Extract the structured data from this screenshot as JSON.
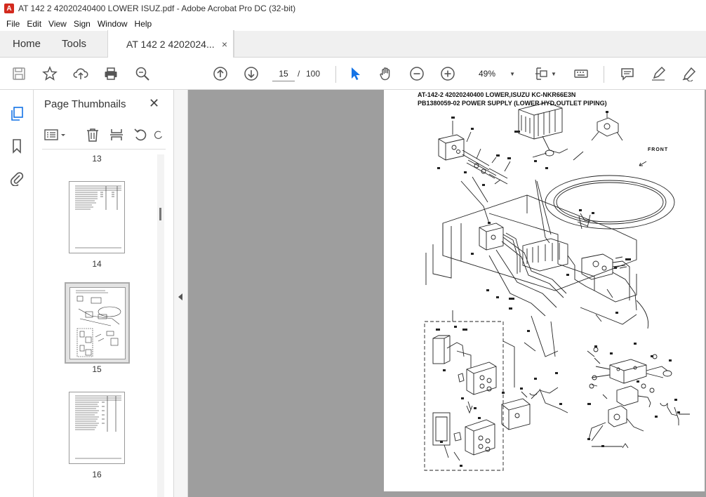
{
  "window": {
    "title": "AT 142 2 42020240400 LOWER ISUZ.pdf - Adobe Acrobat Pro DC (32-bit)",
    "app_icon_glyph": "A"
  },
  "menu": [
    "File",
    "Edit",
    "View",
    "Sign",
    "Window",
    "Help"
  ],
  "tabs": {
    "home": "Home",
    "tools": "Tools",
    "document": "AT 142 2 4202024...",
    "close_glyph": "×"
  },
  "toolbar": {
    "icons": [
      "save-icon",
      "star-icon",
      "upload-icon",
      "print-icon",
      "zoom-search-icon",
      "page-up-icon",
      "page-down-icon",
      "select-arrow-icon",
      "hand-icon",
      "zoom-out-icon",
      "zoom-in-icon",
      "fit-page-icon",
      "keyboard-icon",
      "comment-icon",
      "highlight-icon",
      "sign-icon"
    ],
    "current_page": "15",
    "page_separator": "/",
    "total_pages": "100",
    "zoom": "49%"
  },
  "left_rail": {
    "icons": [
      "page-thumbnails-icon",
      "bookmark-icon",
      "attachment-icon"
    ]
  },
  "thumbnail_panel": {
    "title": "Page Thumbnails",
    "close_glyph": "✕",
    "tools": [
      "thumbnail-options-icon",
      "delete-page-icon",
      "extract-page-icon",
      "rotate-left-icon",
      "rotate-right-icon"
    ],
    "pages": [
      {
        "number": "13",
        "selected": false
      },
      {
        "number": "14",
        "selected": false
      },
      {
        "number": "15",
        "selected": true
      },
      {
        "number": "16",
        "selected": false
      }
    ]
  },
  "document_page": {
    "header_line1": "AT-142-2 42020240400 LOWER,ISUZU KC-NKR66E3N",
    "header_line2": "PB1380059-02 POWER SUPPLY (LOWER HYD.OUTLET PIPING)",
    "front_label": "FRONT"
  },
  "colors": {
    "accent_blue": "#1473e6",
    "viewer_bg": "#9e9e9e",
    "tab_bar_bg": "#f0f0f0",
    "acrobat_red": "#d32a1e"
  }
}
